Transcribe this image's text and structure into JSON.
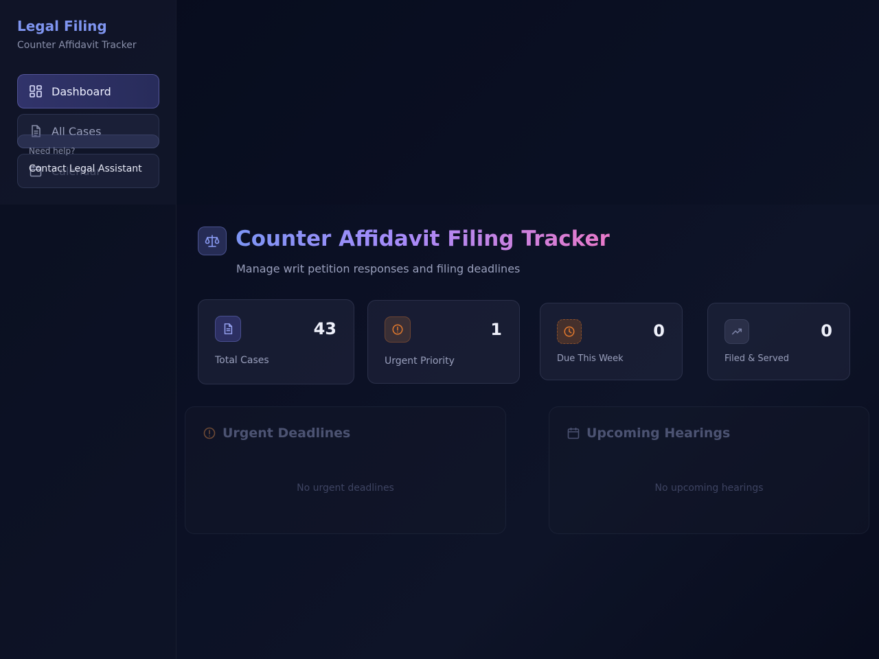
{
  "sidebar": {
    "brand_title": "Legal Filing",
    "brand_subtitle": "Counter Affidavit Tracker",
    "items": [
      {
        "label": "Dashboard",
        "icon": "dashboard-icon",
        "active": true
      },
      {
        "label": "All Cases",
        "icon": "document-icon",
        "active": false
      },
      {
        "label": "Calendar",
        "icon": "calendar-icon",
        "active": false
      }
    ],
    "help_label": "Need help?",
    "help_link": "Contact Legal Assistant"
  },
  "header": {
    "icon": "scale-icon",
    "title": "Counter Affidavit Filing Tracker",
    "subtitle": "Manage writ petition responses and filing deadlines"
  },
  "stats": [
    {
      "label": "Total Cases",
      "value": "43",
      "icon": "document-icon",
      "color": "#8b95f0"
    },
    {
      "label": "Urgent Priority",
      "value": "1",
      "icon": "alert-circle-icon",
      "color": "#e0782d"
    },
    {
      "label": "Due This Week",
      "value": "0",
      "icon": "clock-icon",
      "color": "#e0782d"
    },
    {
      "label": "Filed & Served",
      "value": "0",
      "icon": "trending-up-icon",
      "color": "#7b82a6"
    }
  ],
  "panels": {
    "urgent": {
      "title": "Urgent Deadlines",
      "empty": "No urgent deadlines",
      "icon": "alert-circle-icon"
    },
    "hearings": {
      "title": "Upcoming Hearings",
      "empty": "No upcoming hearings",
      "icon": "calendar-icon"
    }
  },
  "colors": {
    "accent": "#7f95f0",
    "title_gradient": [
      "#7d95f5",
      "#a78bfa",
      "#e879c9"
    ],
    "warning": "#e0782d"
  }
}
